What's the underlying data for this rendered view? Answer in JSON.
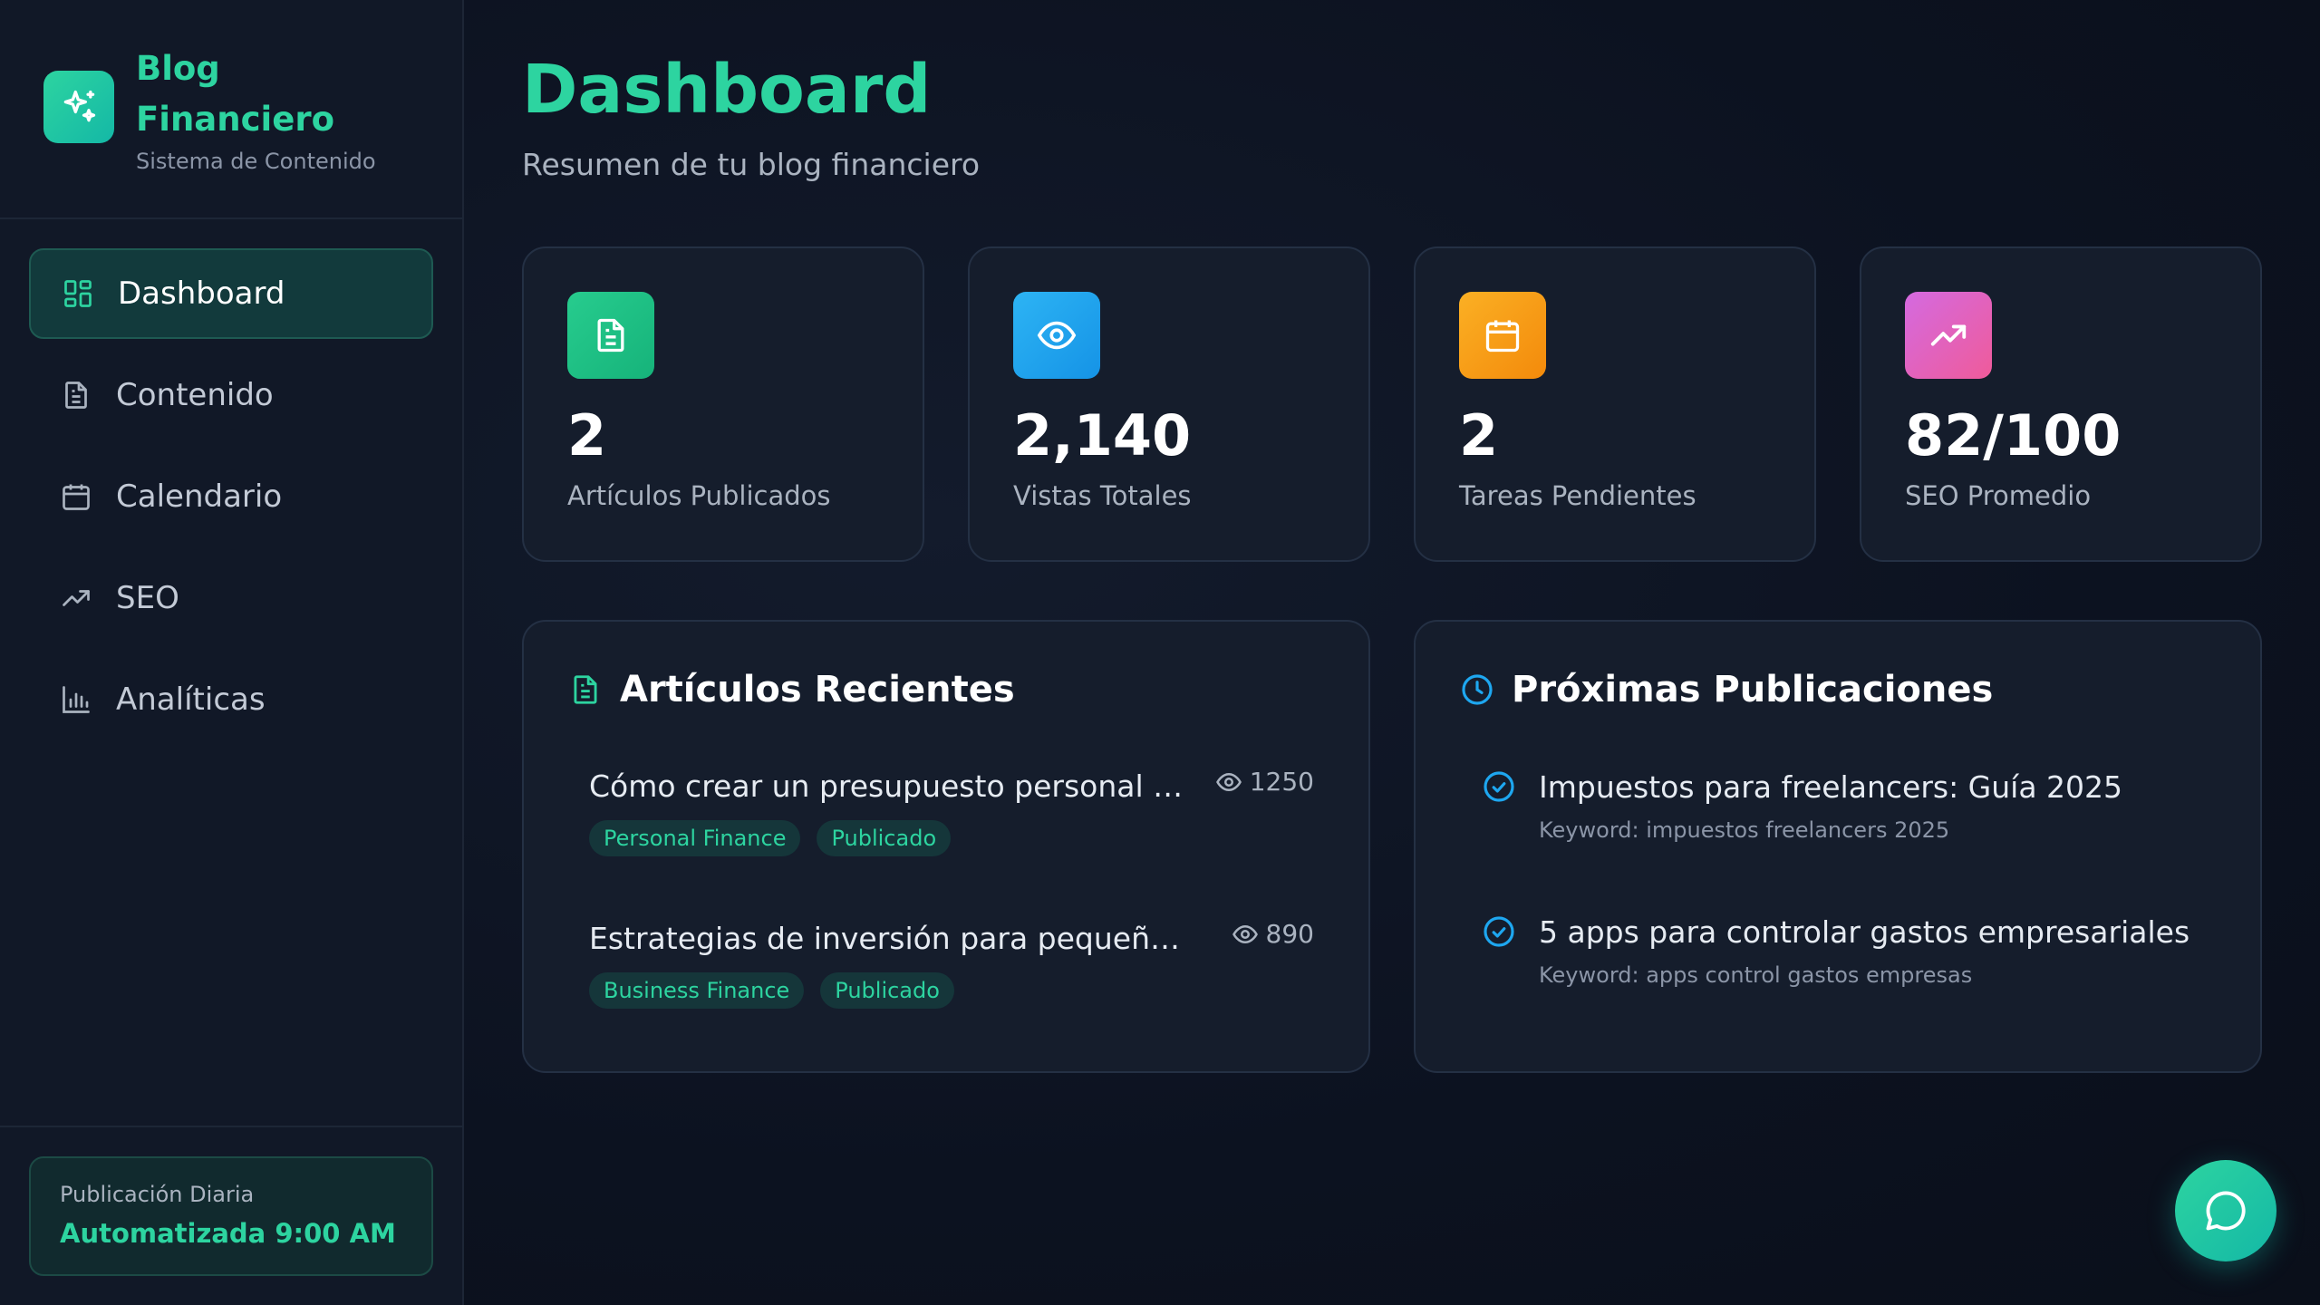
{
  "brand": {
    "title": "Blog Financiero",
    "subtitle": "Sistema de Contenido",
    "icon": "sparkles-icon"
  },
  "sidebar": {
    "items": [
      {
        "label": "Dashboard",
        "icon": "grid-icon",
        "active": true
      },
      {
        "label": "Contenido",
        "icon": "document-icon",
        "active": false
      },
      {
        "label": "Calendario",
        "icon": "calendar-icon",
        "active": false
      },
      {
        "label": "SEO",
        "icon": "trending-up-icon",
        "active": false
      },
      {
        "label": "Analíticas",
        "icon": "bar-chart-icon",
        "active": false
      }
    ],
    "automation": {
      "label": "Publicación Diaria",
      "value": "Automatizada 9:00 AM"
    }
  },
  "header": {
    "title": "Dashboard",
    "subtitle": "Resumen de tu blog financiero"
  },
  "stats": [
    {
      "value": "2",
      "label": "Artículos Publicados",
      "icon": "document-icon",
      "color": "#22c58e"
    },
    {
      "value": "2,140",
      "label": "Vistas Totales",
      "icon": "eye-icon",
      "color": "#1ea7f0"
    },
    {
      "value": "2",
      "label": "Tareas Pendientes",
      "icon": "calendar-icon",
      "color": "#f59e0b"
    },
    {
      "value": "82/100",
      "label": "SEO Promedio",
      "icon": "trending-up-icon",
      "color": "#e85db8"
    }
  ],
  "recent": {
    "title": "Artículos Recientes",
    "icon": "document-icon",
    "articles": [
      {
        "title": "Cómo crear un presupuesto personal efectivo",
        "views": "1250",
        "tags": [
          "Personal Finance",
          "Publicado"
        ]
      },
      {
        "title": "Estrategias de inversión para pequeñas empresas",
        "views": "890",
        "tags": [
          "Business Finance",
          "Publicado"
        ]
      }
    ]
  },
  "upcoming": {
    "title": "Próximas Publicaciones",
    "icon": "clock-icon",
    "items": [
      {
        "title": "Impuestos para freelancers: Guía 2025",
        "keyword": "Keyword: impuestos freelancers 2025"
      },
      {
        "title": "5 apps para controlar gastos empresariales",
        "keyword": "Keyword: apps control gastos empresas"
      }
    ]
  },
  "colors": {
    "accent": "#2dd4a0",
    "background": "#0c1220",
    "card": "#151d2c"
  },
  "chat": {
    "icon": "chat-bubble-icon"
  }
}
